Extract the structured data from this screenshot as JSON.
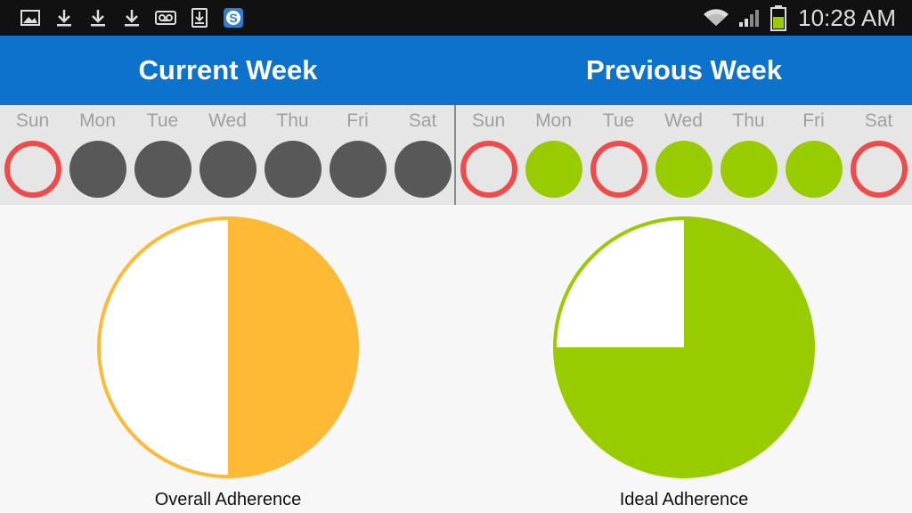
{
  "status_bar": {
    "time": "10:28 AM",
    "left_icons": [
      "image-icon",
      "download-icon",
      "download-icon",
      "download-icon",
      "voicemail-icon",
      "download-box-icon",
      "s-app-icon"
    ],
    "right_icons": [
      "wifi-icon",
      "signal-icon",
      "battery-icon"
    ]
  },
  "header": {
    "current_title": "Current Week",
    "previous_title": "Previous Week",
    "color": "#0d72cc"
  },
  "current_week": {
    "days": [
      {
        "label": "Sun",
        "status": "missed"
      },
      {
        "label": "Mon",
        "status": "pending"
      },
      {
        "label": "Tue",
        "status": "pending"
      },
      {
        "label": "Wed",
        "status": "pending"
      },
      {
        "label": "Thu",
        "status": "pending"
      },
      {
        "label": "Fri",
        "status": "pending"
      },
      {
        "label": "Sat",
        "status": "pending"
      }
    ]
  },
  "previous_week": {
    "days": [
      {
        "label": "Sun",
        "status": "missed"
      },
      {
        "label": "Mon",
        "status": "taken"
      },
      {
        "label": "Tue",
        "status": "missed"
      },
      {
        "label": "Wed",
        "status": "taken"
      },
      {
        "label": "Thu",
        "status": "taken"
      },
      {
        "label": "Fri",
        "status": "taken"
      },
      {
        "label": "Sat",
        "status": "missed"
      }
    ]
  },
  "status_colors": {
    "missed": "#f04b4b",
    "pending": "#585858",
    "taken": "#99cc00"
  },
  "chart_data": [
    {
      "type": "pie",
      "title": "Overall Adherence",
      "slices": [
        {
          "label": "adherent",
          "value": 50,
          "color": "#ffba35"
        },
        {
          "label": "remaining",
          "value": 50,
          "color": "#ffffff"
        }
      ],
      "outline_color": "#ffba35"
    },
    {
      "type": "pie",
      "title": "Ideal Adherence",
      "slices": [
        {
          "label": "adherent",
          "value": 75,
          "color": "#99cc00"
        },
        {
          "label": "remaining",
          "value": 25,
          "color": "#ffffff"
        }
      ],
      "outline_color": "#99cc00"
    }
  ]
}
